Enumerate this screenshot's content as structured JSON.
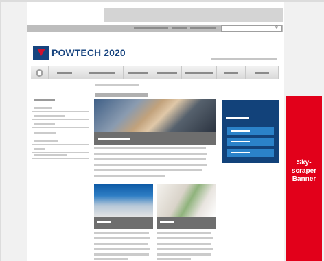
{
  "header": {
    "logo_text": "POWTECH 2020",
    "logo_mark": "powtech-triangle-logo",
    "search_icon": "magnifier-icon"
  },
  "nav": {
    "home_icon": "home-icon",
    "item_count": 7
  },
  "ad": {
    "label_line1": "Sky-",
    "label_line2": "scraper",
    "label_line3": "Banner",
    "background": "#e2001a"
  },
  "colors": {
    "brand_blue": "#17447f",
    "brand_red": "#d0102d",
    "panel_blue": "#12427a",
    "button_blue": "#2b82c9",
    "caption_gray": "#6e6e6e"
  }
}
